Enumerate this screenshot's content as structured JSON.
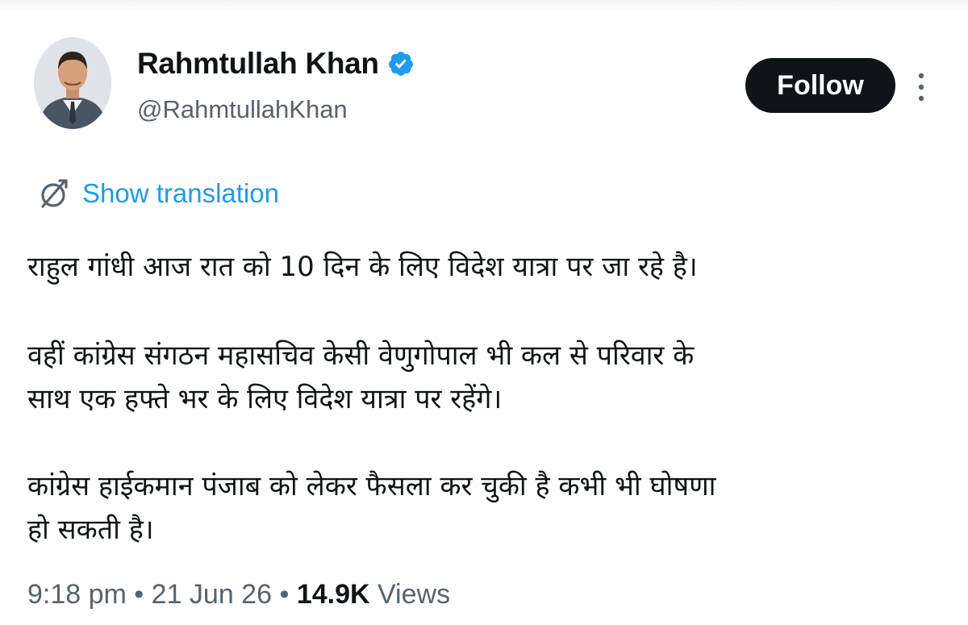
{
  "author": {
    "display_name": "Rahmtullah Khan",
    "handle": "@RahmtullahKhan",
    "verified_icon": "verified-badge-icon",
    "verified_color": "#1d9bf0"
  },
  "actions": {
    "follow_label": "Follow",
    "more_icon": "more-vertical-icon"
  },
  "translation": {
    "label": "Show translation",
    "icon": "translate-globe-icon",
    "color": "#1d9bf0"
  },
  "tweet": {
    "lines": [
      "राहुल गांधी आज रात को 10 दिन के लिए विदेश यात्रा पर जा रहे है।",
      "वहीं कांग्रेस संगठन महासचिव केसी वेणुगोपाल भी कल से परिवार के",
      "साथ एक हफ्ते भर के लिए विदेश यात्रा पर रहेंगे।",
      "कांग्रेस हाईकमान पंजाब को लेकर फैसला कर चुकी है कभी भी घोषणा",
      "हो सकती है।"
    ]
  },
  "meta": {
    "time": "9:18 pm",
    "separator": " • ",
    "date": "21 Jun 26",
    "views_count": "14.9K",
    "views_label": " Views"
  }
}
